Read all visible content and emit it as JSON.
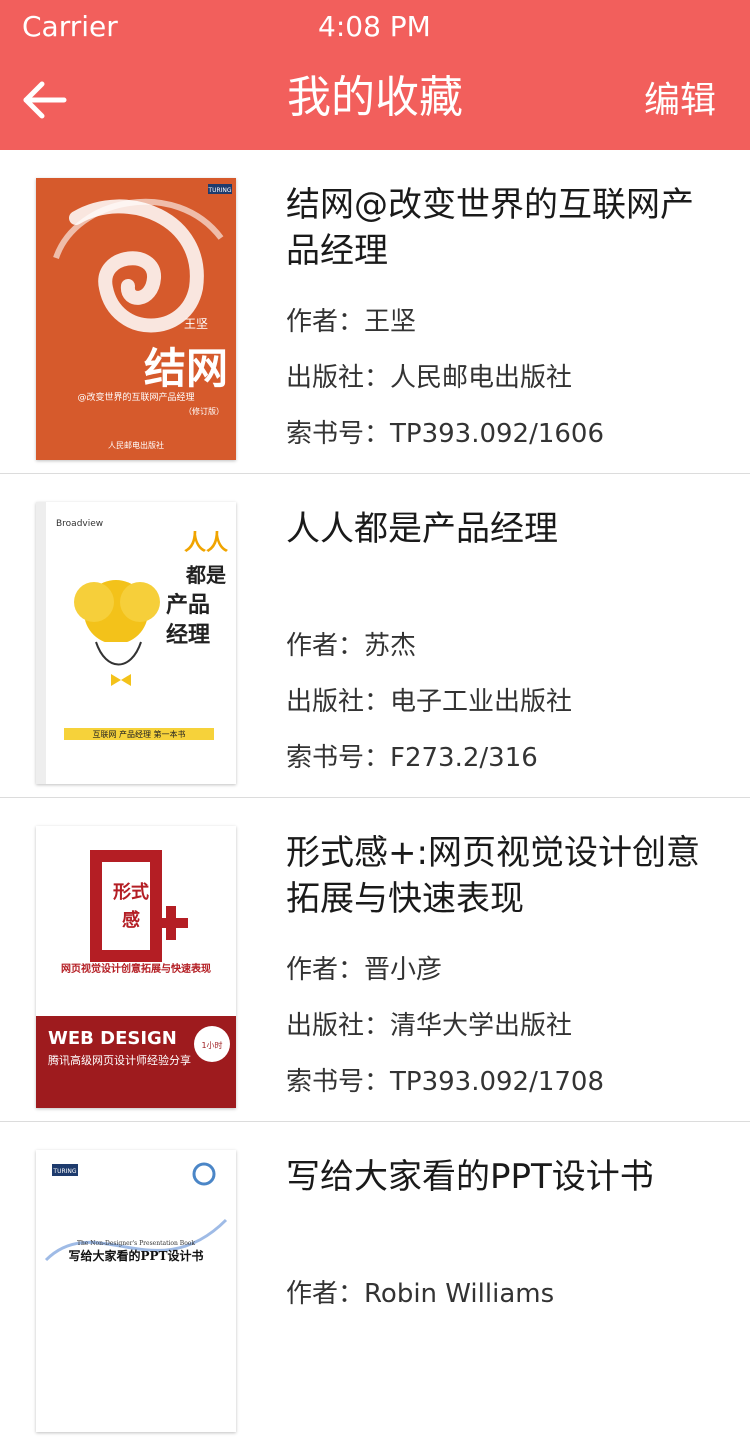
{
  "status_bar": {
    "carrier": "Carrier",
    "time": "4:08 PM"
  },
  "nav": {
    "title": "我的收藏",
    "edit_label": "编辑",
    "back_icon": "back-arrow-icon"
  },
  "labels": {
    "author": "作者：",
    "publisher": "出版社：",
    "call_number": "索书号："
  },
  "books": [
    {
      "title": "结网@改变世界的互联网产品经理",
      "author": "王坚",
      "publisher": "人民邮电出版社",
      "call_number": "TP393.092/1606",
      "cover": {
        "top_text": "TURING",
        "big": "结网",
        "author": "王坚",
        "sub": "@改变世界的互联网产品经理",
        "edition": "（修订版）",
        "press": "人民邮电出版社"
      }
    },
    {
      "title": "人人都是产品经理",
      "author": "苏杰",
      "publisher": "电子工业出版社",
      "call_number": "F273.2/316",
      "cover": {
        "top_text": "Broadview",
        "big": "人人都是产品经理",
        "tag": "互联网 产品经理 第一本书"
      }
    },
    {
      "title": "形式感+:网页视觉设计创意拓展与快速表现",
      "author": "晋小彦",
      "publisher": "清华大学出版社",
      "call_number": "TP393.092/1708",
      "cover": {
        "big": "形式感",
        "sub": "网页视觉设计创意拓展与快速表现",
        "web": "WEB DESIGN",
        "web_sub": "腾讯高级网页设计师经验分享"
      }
    },
    {
      "title": "写给大家看的PPT设计书",
      "author": "Robin Williams",
      "publisher": "",
      "call_number": "",
      "cover": {
        "top_text": "TURING",
        "en": "The Non-Designer's Presentation Book",
        "big": "写给大家看的PPT设计书"
      }
    }
  ]
}
